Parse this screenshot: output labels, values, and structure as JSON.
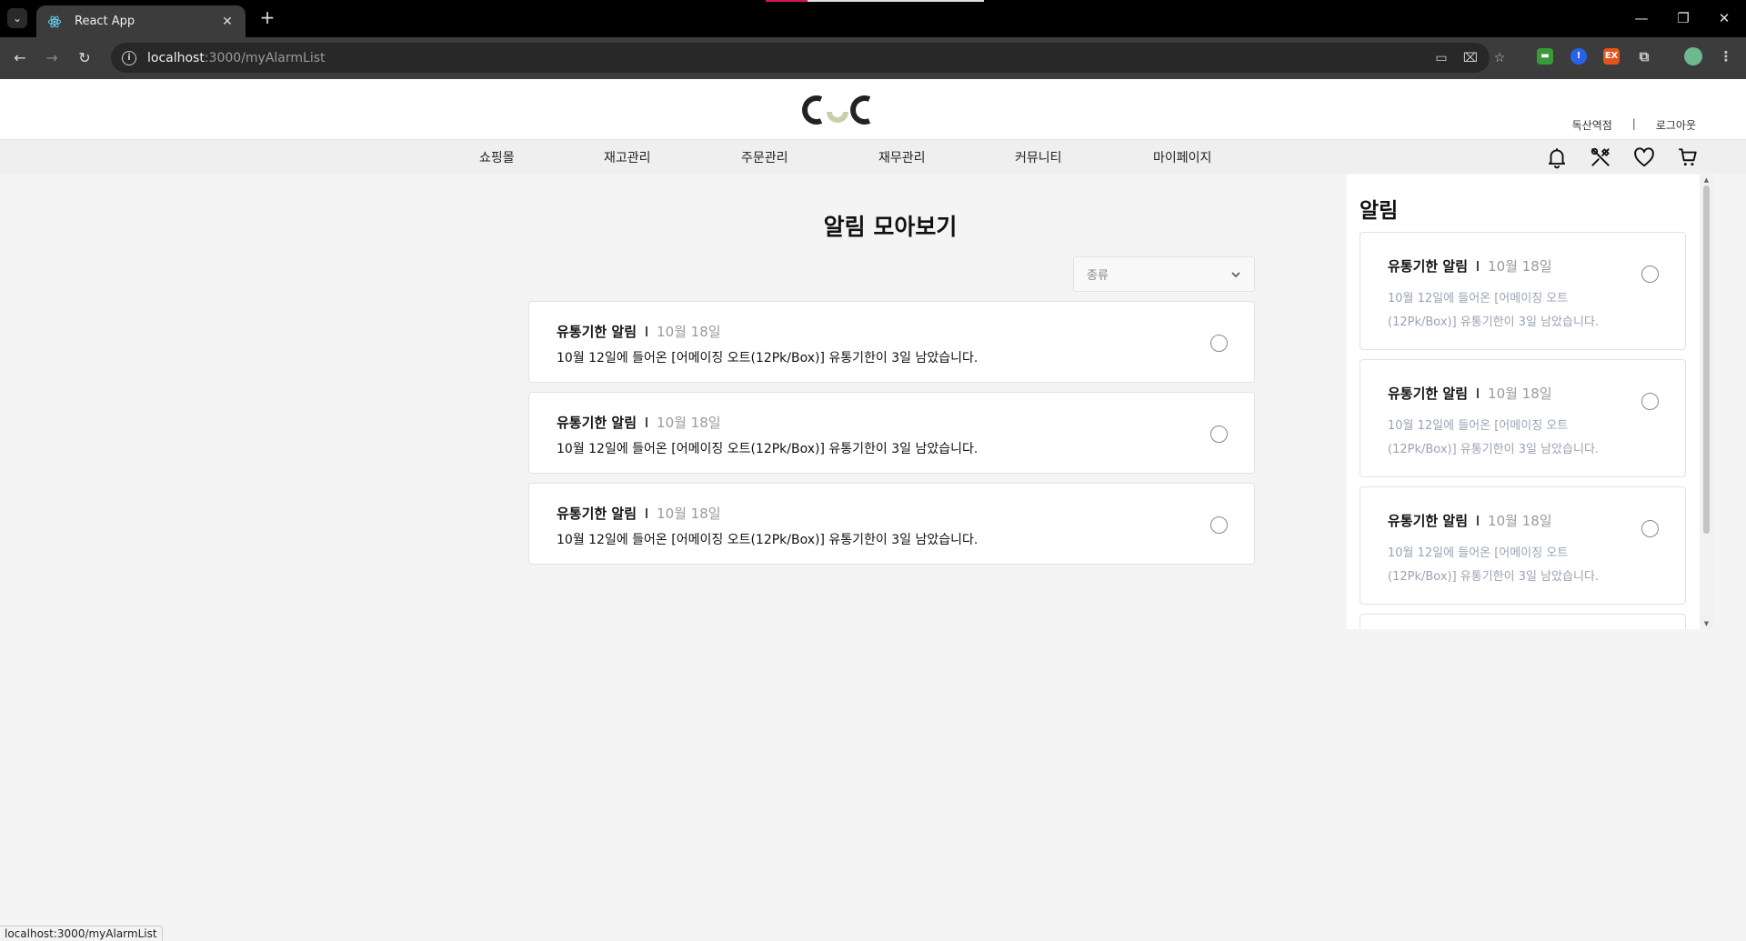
{
  "browser": {
    "tab_title": "React App",
    "url_host": "localhost",
    "url_path": ":3000/myAlarmList",
    "status_url": "localhost:3000/myAlarmList"
  },
  "header": {
    "logo_alt": "CuC",
    "user_name": "독산역점",
    "separator": "|",
    "logout": "로그아웃",
    "nav": [
      "쇼핑몰",
      "재고관리",
      "주문관리",
      "재무관리",
      "커뮤니티",
      "마이페이지"
    ],
    "icons": [
      "bell-icon",
      "tools-icon",
      "heart-icon",
      "cart-icon"
    ]
  },
  "main": {
    "title": "알림 모아보기",
    "filter_placeholder": "종류",
    "alarms": [
      {
        "type": "유통기한 알림",
        "date": "10월 18일",
        "message": "10월 12일에 들어온 [어메이징 오트(12Pk/Box)] 유통기한이 3일 남았습니다."
      },
      {
        "type": "유통기한 알림",
        "date": "10월 18일",
        "message": "10월 12일에 들어온 [어메이징 오트(12Pk/Box)] 유통기한이 3일 남았습니다."
      },
      {
        "type": "유통기한 알림",
        "date": "10월 18일",
        "message": "10월 12일에 들어온 [어메이징 오트(12Pk/Box)] 유통기한이 3일 남았습니다."
      }
    ]
  },
  "side_panel": {
    "title": "알림",
    "alarms": [
      {
        "type": "유통기한 알림",
        "date": "10월 18일",
        "line1": "10월 12일에 들어온 [어메이징 오트",
        "line2": "(12Pk/Box)] 유통기한이 3일 남았습니다."
      },
      {
        "type": "유통기한 알림",
        "date": "10월 18일",
        "line1": "10월 12일에 들어온 [어메이징 오트",
        "line2": "(12Pk/Box)] 유통기한이 3일 남았습니다."
      },
      {
        "type": "유통기한 알림",
        "date": "10월 18일",
        "line1": "10월 12일에 들어온 [어메이징 오트",
        "line2": "(12Pk/Box)] 유통기한이 3일 남았습니다."
      }
    ]
  },
  "colors": {
    "logo_dark": "#222222",
    "logo_accent": "#c9cfa8",
    "date_gray": "#9a9a9a",
    "side_body": "#9aa3b5"
  }
}
